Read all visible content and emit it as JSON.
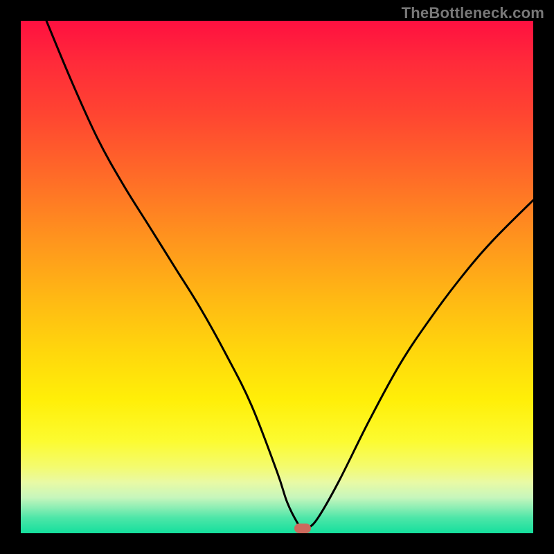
{
  "attribution": "TheBottleneck.com",
  "colors": {
    "page_bg": "#000000",
    "curve": "#000000",
    "marker": "#cc6a5d",
    "attribution_text": "#787878"
  },
  "chart_data": {
    "type": "line",
    "title": "",
    "xlabel": "",
    "ylabel": "",
    "xlim": [
      0,
      100
    ],
    "ylim": [
      0,
      100
    ],
    "grid": false,
    "legend": false,
    "series": [
      {
        "name": "bottleneck-curve",
        "x": [
          5,
          10,
          15,
          20,
          25,
          30,
          35,
          40,
          45,
          50,
          52,
          54,
          55,
          56,
          58,
          62,
          68,
          74,
          80,
          86,
          92,
          100
        ],
        "y": [
          100,
          88,
          77,
          68,
          60,
          52,
          44,
          35,
          25,
          12,
          6,
          2,
          1,
          1,
          3,
          10,
          22,
          33,
          42,
          50,
          57,
          65
        ]
      }
    ],
    "annotations": [
      {
        "type": "marker",
        "x": 55,
        "y": 1,
        "shape": "rounded-rect",
        "color": "#cc6a5d"
      }
    ]
  }
}
